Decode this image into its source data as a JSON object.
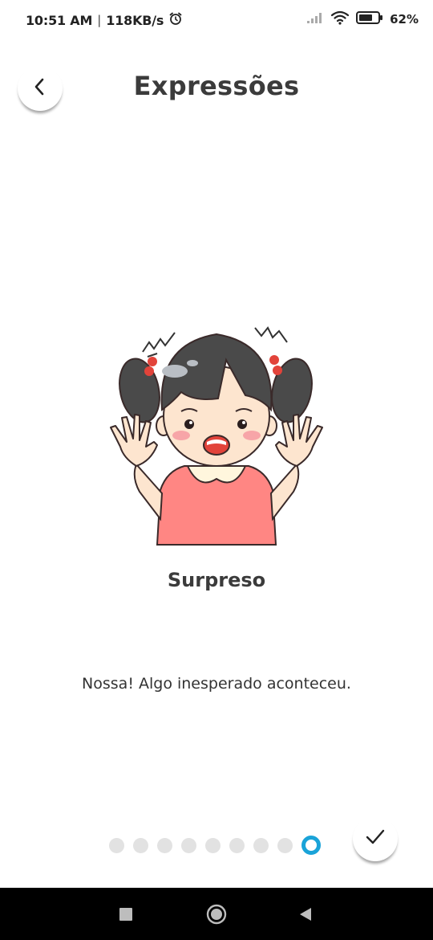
{
  "status_bar": {
    "time": "10:51 AM",
    "separator": "|",
    "network_speed": "118KB/s",
    "icons": [
      "alarm-icon",
      "signal-icon",
      "wifi-icon",
      "battery-icon"
    ],
    "battery_percent": "62%"
  },
  "header": {
    "title": "Expressões",
    "back_icon": "chevron-left-icon"
  },
  "card": {
    "image": "surprised-girl-illustration",
    "expression_name": "Surpreso",
    "description": "Nossa! Algo inesperado aconteceu."
  },
  "pagination": {
    "total": 9,
    "active_index": 8,
    "active_color": "#1aa3d8",
    "inactive_color": "#e2e2e2"
  },
  "confirm": {
    "icon": "check-icon"
  },
  "nav_bar": {
    "buttons": [
      "recents-square-icon",
      "home-circle-icon",
      "back-triangle-icon"
    ]
  }
}
